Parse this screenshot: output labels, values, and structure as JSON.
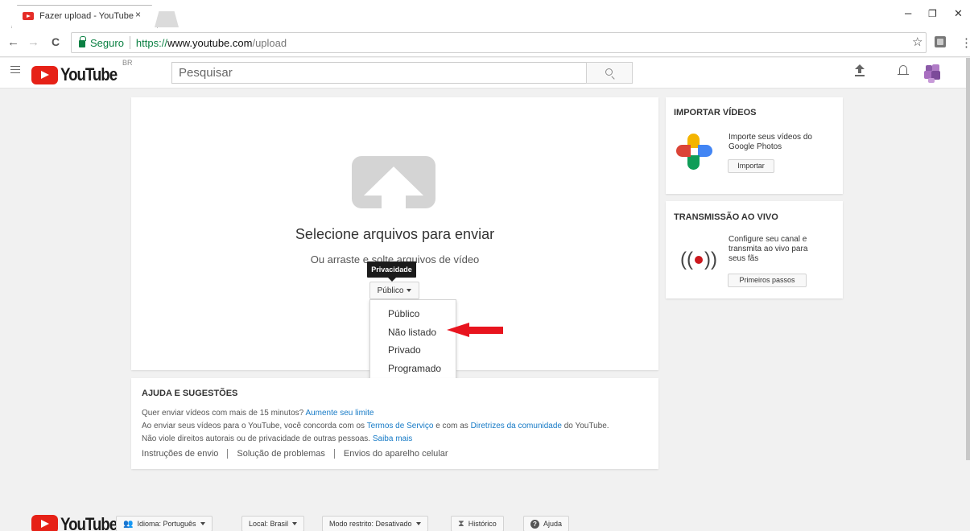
{
  "browser": {
    "tab_title": "Fazer upload - YouTube",
    "tab_close": "×",
    "window_controls": {
      "minimize": "–",
      "maximize": "❐",
      "close": "✕"
    },
    "nav": {
      "back": "←",
      "forward": "→",
      "reload": "C"
    },
    "address": {
      "secure_label": "Seguro",
      "url_scheme": "https://",
      "url_host": "www.youtube.com",
      "url_path": "/upload"
    },
    "bookmark_star": "☆",
    "menu_kebab": "⋮"
  },
  "header": {
    "logo_text": "YouTube",
    "region_badge": "BR",
    "search_placeholder": "Pesquisar"
  },
  "upload": {
    "title": "Selecione arquivos para enviar",
    "subtitle": "Ou arraste e solte arquivos de vídeo",
    "privacy_tooltip": "Privacidade",
    "privacy_selected": "Público",
    "privacy_options": [
      "Público",
      "Não listado",
      "Privado",
      "Programado"
    ]
  },
  "help": {
    "title": "AJUDA E SUGESTÕES",
    "line1_text": "Quer enviar vídeos com mais de 15 minutos? ",
    "line1_link": "Aumente seu limite",
    "line2_text_a": "Ao enviar seus vídeos para o YouTube, você concorda com os ",
    "line2_link_a": "Termos de Serviço",
    "line2_text_b": " e com as ",
    "line2_link_b": "Diretrizes da comunidade",
    "line2_text_c": " do YouTube.",
    "line3_text": "Não viole direitos autorais ou de privacidade de outras pessoas. ",
    "line3_link": "Saiba mais",
    "links": [
      "Instruções de envio",
      "Solução de problemas",
      "Envios do aparelho celular"
    ]
  },
  "import_card": {
    "title": "IMPORTAR VÍDEOS",
    "desc_line1": "Importe seus vídeos do",
    "desc_line2": "Google Photos",
    "button": "Importar"
  },
  "live_card": {
    "title": "TRANSMISSÃO AO VIVO",
    "desc_line1": "Configure seu canal e",
    "desc_line2": "transmita ao vivo para",
    "desc_line3": "seus fãs",
    "button": "Primeiros passos"
  },
  "footer": {
    "logo_text": "YouTube",
    "language": "Idioma: Português",
    "location": "Local: Brasil",
    "restricted": "Modo restrito: Desativado",
    "history": "Histórico",
    "help": "Ajuda"
  },
  "colors": {
    "youtube_red": "#e62117",
    "link_blue": "#167ac6",
    "secure_green": "#0b8043",
    "annotation_arrow": "#e8141e"
  }
}
